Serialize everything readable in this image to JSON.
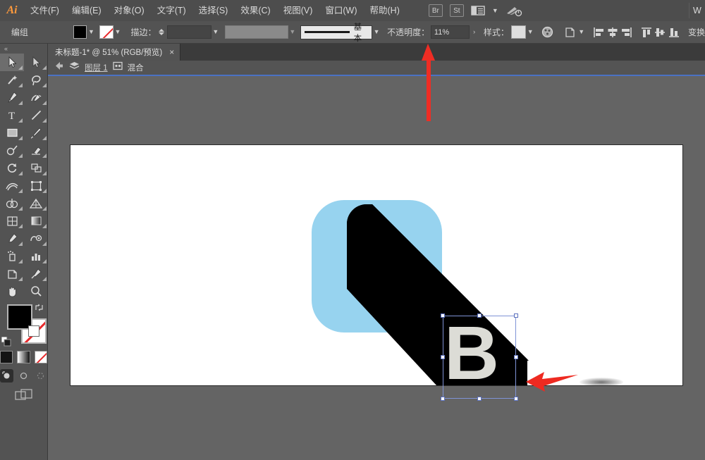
{
  "app": {
    "logo": "Ai",
    "edge_label": "W"
  },
  "menubar": {
    "items": [
      {
        "label": "文件(F)",
        "name": "menu-file"
      },
      {
        "label": "编辑(E)",
        "name": "menu-edit"
      },
      {
        "label": "对象(O)",
        "name": "menu-object"
      },
      {
        "label": "文字(T)",
        "name": "menu-type"
      },
      {
        "label": "选择(S)",
        "name": "menu-select"
      },
      {
        "label": "效果(C)",
        "name": "menu-effect"
      },
      {
        "label": "视图(V)",
        "name": "menu-view"
      },
      {
        "label": "窗口(W)",
        "name": "menu-window"
      },
      {
        "label": "帮助(H)",
        "name": "menu-help"
      }
    ],
    "bridge_label": "Br",
    "stock_label": "St",
    "workspace_icon": "workspace-switcher-icon",
    "cc_icon": "creative-cloud-icon"
  },
  "controlbar": {
    "selection_label": "编组",
    "fill_color": "#000000",
    "stroke_color": "none",
    "stroke_label": "描边：",
    "stroke_weight_value": "",
    "stroke_weight_placeholder": "",
    "variable_width_value": "",
    "profile_label": "基本",
    "opacity_label": "不透明度：",
    "opacity_value": "11%",
    "style_label": "样式：",
    "style_swatch": "#dedede",
    "recolor_icon": "recolor-artwork-icon",
    "shapemode_icon": "shape-mode-icon",
    "align_icons": [
      "align-left-icon",
      "align-center-horizontal-icon",
      "align-right-icon",
      "align-top-icon",
      "align-center-vertical-icon",
      "align-bottom-icon"
    ],
    "transform_label": "变换"
  },
  "tabbar": {
    "title": "未标题-1* @ 51% (RGB/预览)",
    "close": "×"
  },
  "layerbar": {
    "back_icon": "back-arrow-icon",
    "layers_icon": "layers-icon",
    "layer_name": "图层 1",
    "blend_icon": "isolation-icon",
    "blend_label": "混合"
  },
  "toolbar": {
    "collapse": "«",
    "tools": [
      {
        "name": "selection-tool",
        "icon": "arrow-solid",
        "active": true
      },
      {
        "name": "direct-selection-tool",
        "icon": "arrow-hollow",
        "active": false
      },
      {
        "name": "magic-wand-tool",
        "icon": "magic-wand",
        "active": false
      },
      {
        "name": "lasso-tool",
        "icon": "lasso",
        "active": false
      },
      {
        "name": "pen-tool",
        "icon": "pen",
        "active": false
      },
      {
        "name": "curvature-tool",
        "icon": "curvature",
        "active": false
      },
      {
        "name": "type-tool",
        "icon": "type-T",
        "active": false
      },
      {
        "name": "line-segment-tool",
        "icon": "line",
        "active": false
      },
      {
        "name": "rectangle-tool",
        "icon": "rectangle",
        "active": false
      },
      {
        "name": "paintbrush-tool",
        "icon": "paintbrush",
        "active": false
      },
      {
        "name": "shaper-tool",
        "icon": "shaper",
        "active": false
      },
      {
        "name": "eraser-tool",
        "icon": "eraser",
        "active": false
      },
      {
        "name": "rotate-tool",
        "icon": "rotate",
        "active": false
      },
      {
        "name": "scale-tool",
        "icon": "scale",
        "active": false
      },
      {
        "name": "width-tool",
        "icon": "width",
        "active": false
      },
      {
        "name": "free-transform-tool",
        "icon": "free-transform",
        "active": false
      },
      {
        "name": "shape-builder-tool",
        "icon": "shape-builder",
        "active": false
      },
      {
        "name": "perspective-grid-tool",
        "icon": "perspective-grid",
        "active": false
      },
      {
        "name": "mesh-tool",
        "icon": "mesh",
        "active": false
      },
      {
        "name": "gradient-tool",
        "icon": "gradient",
        "active": false
      },
      {
        "name": "eyedropper-tool",
        "icon": "eyedropper",
        "active": false
      },
      {
        "name": "blend-tool",
        "icon": "blend",
        "active": false
      },
      {
        "name": "symbol-sprayer-tool",
        "icon": "symbol-sprayer",
        "active": false
      },
      {
        "name": "column-graph-tool",
        "icon": "bar-graph",
        "active": false
      },
      {
        "name": "artboard-tool",
        "icon": "artboard",
        "active": false
      },
      {
        "name": "slice-tool",
        "icon": "slice-knife",
        "active": false
      },
      {
        "name": "hand-tool",
        "icon": "hand",
        "active": false
      },
      {
        "name": "zoom-tool",
        "icon": "magnifier",
        "active": false
      }
    ],
    "fill_color": "#000000",
    "stroke_color": "none",
    "swap_icon": "swap-fill-stroke-icon",
    "defaults_icon": "default-fill-stroke-icon",
    "color_modes": [
      {
        "name": "color-mode-solid",
        "type": "solid"
      },
      {
        "name": "color-mode-gradient",
        "type": "gradient"
      },
      {
        "name": "color-mode-none",
        "type": "none"
      }
    ],
    "draw_modes": [
      {
        "name": "draw-normal-mode",
        "active": true
      },
      {
        "name": "draw-behind-mode",
        "active": false
      },
      {
        "name": "draw-inside-mode",
        "active": false
      }
    ],
    "screen_mode": "change-screen-mode-icon"
  },
  "canvas": {
    "artboard_bg": "#ffffff",
    "background": "#646464",
    "shapes": [
      {
        "name": "blue-rounded-square",
        "color": "#97d3ef"
      },
      {
        "name": "black-extruded-shape",
        "color": "#000000"
      },
      {
        "name": "letter-b-shape",
        "fill": "#dcdcd6",
        "text": "B"
      },
      {
        "name": "soft-shadow-ellipse",
        "color": "#8c8c8c"
      }
    ],
    "selection": {
      "name": "selection-bounding-box",
      "color": "#7f93d6",
      "handles": 8
    }
  },
  "annotations": [
    {
      "name": "red-arrow-up-opacity",
      "color": "#ef2d24",
      "direction": "up"
    },
    {
      "name": "red-arrow-left-letter",
      "color": "#ee2a21",
      "direction": "left"
    }
  ]
}
